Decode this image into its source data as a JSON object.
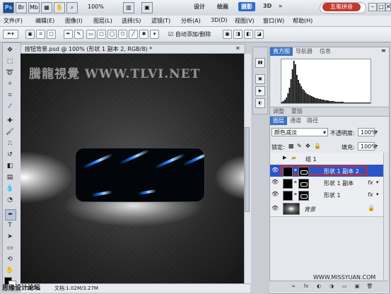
{
  "topbar": {
    "badges": [
      "Ps",
      "Br",
      "Mb"
    ],
    "zoom": "100%",
    "workspaces": [
      "设计",
      "绘画",
      "摄影",
      "3D"
    ],
    "active_workspace": "摄影",
    "more": "»",
    "ime_label": "五笔拼音",
    "window_buttons": [
      "–",
      "□",
      "✕"
    ]
  },
  "menu": {
    "items": [
      "文件(F)",
      "编辑(E)",
      "图像(I)",
      "图层(L)",
      "选择(S)",
      "滤镜(T)",
      "分析(A)",
      "3D(D)",
      "视图(V)",
      "窗口(W)",
      "帮助(H)"
    ]
  },
  "options_bar": {
    "auto_add_delete": "自动添加/删除",
    "checked": true
  },
  "document": {
    "tab_title": "按钮背景.psd @ 100% (形状 1 副本 2, RGB/8) *",
    "watermark": "騰龍視覺 WWW.TLVI.NET",
    "zoom": "100%",
    "doc_size": "文档:1.02M/3.27M",
    "forum_watermark": "思缘设计论坛"
  },
  "histogram_panel": {
    "tabs": [
      "直方图",
      "导航器",
      "信息"
    ],
    "active_tab": "直方图",
    "bins": [
      2,
      3,
      5,
      8,
      14,
      22,
      34,
      48,
      60,
      55,
      40,
      33,
      28,
      24,
      20,
      18,
      15,
      13,
      12,
      11,
      10,
      9,
      8,
      7,
      7,
      6,
      6,
      5,
      5,
      4,
      4,
      4,
      3,
      3,
      3,
      3,
      2,
      2,
      2,
      2,
      2,
      2,
      1,
      1,
      1,
      1,
      1,
      1,
      1,
      1,
      1,
      1,
      1,
      1,
      1,
      1,
      1,
      1,
      1,
      1
    ]
  },
  "adjustments_bar": {
    "tabs": [
      "调整",
      "蒙版"
    ]
  },
  "layers_panel": {
    "tabs": [
      "图层",
      "通道",
      "路径"
    ],
    "active_tab": "图层",
    "blend_mode": "颜色减淡",
    "opacity_label": "不透明度:",
    "opacity_value": "100%",
    "lock_label": "锁定:",
    "fill_label": "填充:",
    "fill_value": "100%",
    "layers": [
      {
        "name": "组 1",
        "type": "group",
        "visible": false
      },
      {
        "name": "形状 1 副本 2",
        "type": "shape",
        "selected": true,
        "visible": true,
        "fx": ""
      },
      {
        "name": "形状 1 副本",
        "type": "shape",
        "selected": false,
        "visible": true,
        "fx": "fx"
      },
      {
        "name": "形状 1",
        "type": "shape",
        "selected": false,
        "visible": true,
        "fx": "fx"
      },
      {
        "name": "背景",
        "type": "background",
        "selected": false,
        "visible": true,
        "fx": ""
      }
    ],
    "site_watermark": "WWW.MISSYUAN.COM",
    "bottom_icons": [
      "∞",
      "fx",
      "◐",
      "◑",
      "▭",
      "▣",
      "🗑"
    ]
  },
  "colors": {
    "selection_red": "#d12a2a",
    "selected_row": "#2a55c8",
    "streak_blue": "#1a7cff"
  }
}
